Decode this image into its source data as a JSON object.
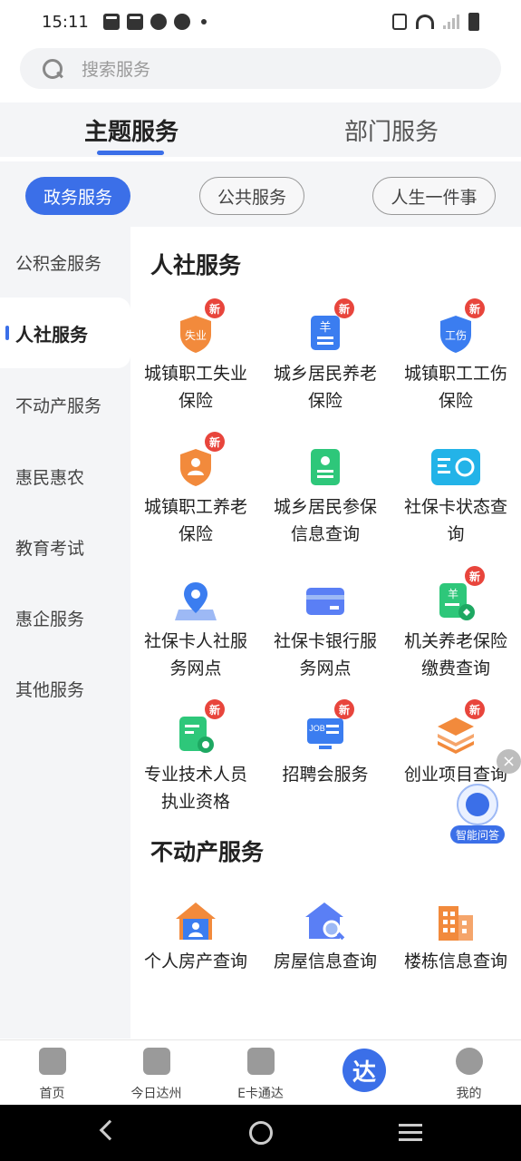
{
  "status_bar": {
    "time": "15:11"
  },
  "search": {
    "placeholder": "搜索服务"
  },
  "top_tabs": [
    {
      "label": "主题服务",
      "active": true
    },
    {
      "label": "部门服务",
      "active": false
    }
  ],
  "pills": [
    {
      "label": "政务服务",
      "active": true
    },
    {
      "label": "公共服务"
    },
    {
      "label": "人生一件事"
    }
  ],
  "sidebar": {
    "items": [
      {
        "label": "公积金服务"
      },
      {
        "label": "人社服务",
        "active": true
      },
      {
        "label": "不动产服务"
      },
      {
        "label": "惠民惠农"
      },
      {
        "label": "教育考试"
      },
      {
        "label": "惠企服务"
      },
      {
        "label": "其他服务"
      }
    ]
  },
  "new_badge": "新",
  "sections": [
    {
      "title": "人社服务",
      "items": [
        {
          "label": "城镇职工失业保险",
          "icon": "unemployment-shield-icon",
          "icon_text": "失业",
          "is_new": true,
          "color": "#f28a3c"
        },
        {
          "label": "城乡居民养老保险",
          "icon": "pension-card-icon",
          "icon_text": "羊",
          "is_new": true,
          "color": "#3b7df0"
        },
        {
          "label": "城镇职工工伤保险",
          "icon": "work-injury-shield-icon",
          "icon_text": "工伤",
          "is_new": true,
          "color": "#3b7df0"
        },
        {
          "label": "城镇职工养老保险",
          "icon": "elder-shield-icon",
          "icon_text": "",
          "is_new": true,
          "color": "#f28a3c"
        },
        {
          "label": "城乡居民参保信息查询",
          "icon": "insured-info-icon",
          "icon_text": "",
          "is_new": false,
          "color": "#2ec77a"
        },
        {
          "label": "社保卡状态查询",
          "icon": "card-status-icon",
          "icon_text": "",
          "is_new": false,
          "color": "#23b3e8"
        },
        {
          "label": "社保卡人社服务网点",
          "icon": "location-pin-icon",
          "icon_text": "",
          "is_new": false,
          "color": "#3b7df0"
        },
        {
          "label": "社保卡银行服务网点",
          "icon": "bank-card-icon",
          "icon_text": "",
          "is_new": false,
          "color": "#5a7ff5"
        },
        {
          "label": "机关养老保险缴费查询",
          "icon": "payment-doc-icon",
          "icon_text": "羊",
          "is_new": true,
          "color": "#2ec77a"
        },
        {
          "label": "专业技术人员执业资格",
          "icon": "certificate-icon",
          "icon_text": "",
          "is_new": true,
          "color": "#2ec77a"
        },
        {
          "label": "招聘会服务",
          "icon": "job-fair-icon",
          "icon_text": "JOB",
          "is_new": true,
          "color": "#3b7df0"
        },
        {
          "label": "创业项目查询",
          "icon": "layers-icon",
          "icon_text": "",
          "is_new": true,
          "color": "#f28a3c"
        }
      ]
    },
    {
      "title": "不动产服务",
      "items": [
        {
          "label": "个人房产查询",
          "icon": "home-person-icon",
          "icon_text": "",
          "is_new": false,
          "color": "#3b7df0"
        },
        {
          "label": "房屋信息查询",
          "icon": "house-search-icon",
          "icon_text": "",
          "is_new": false,
          "color": "#5a7ff5"
        },
        {
          "label": "楼栋信息查询",
          "icon": "building-icon",
          "icon_text": "",
          "is_new": false,
          "color": "#f28a3c"
        }
      ]
    }
  ],
  "float_assistant": {
    "label": "智能问答"
  },
  "bottom_nav": [
    {
      "label": "首页",
      "icon": "home-pavilion-icon"
    },
    {
      "label": "今日达州",
      "icon": "play-screen-icon"
    },
    {
      "label": "E卡通达",
      "icon": "qr-code-icon"
    },
    {
      "label": "",
      "icon": "da-logo-icon",
      "center_text": "达"
    },
    {
      "label": "我的",
      "icon": "profile-icon"
    }
  ]
}
